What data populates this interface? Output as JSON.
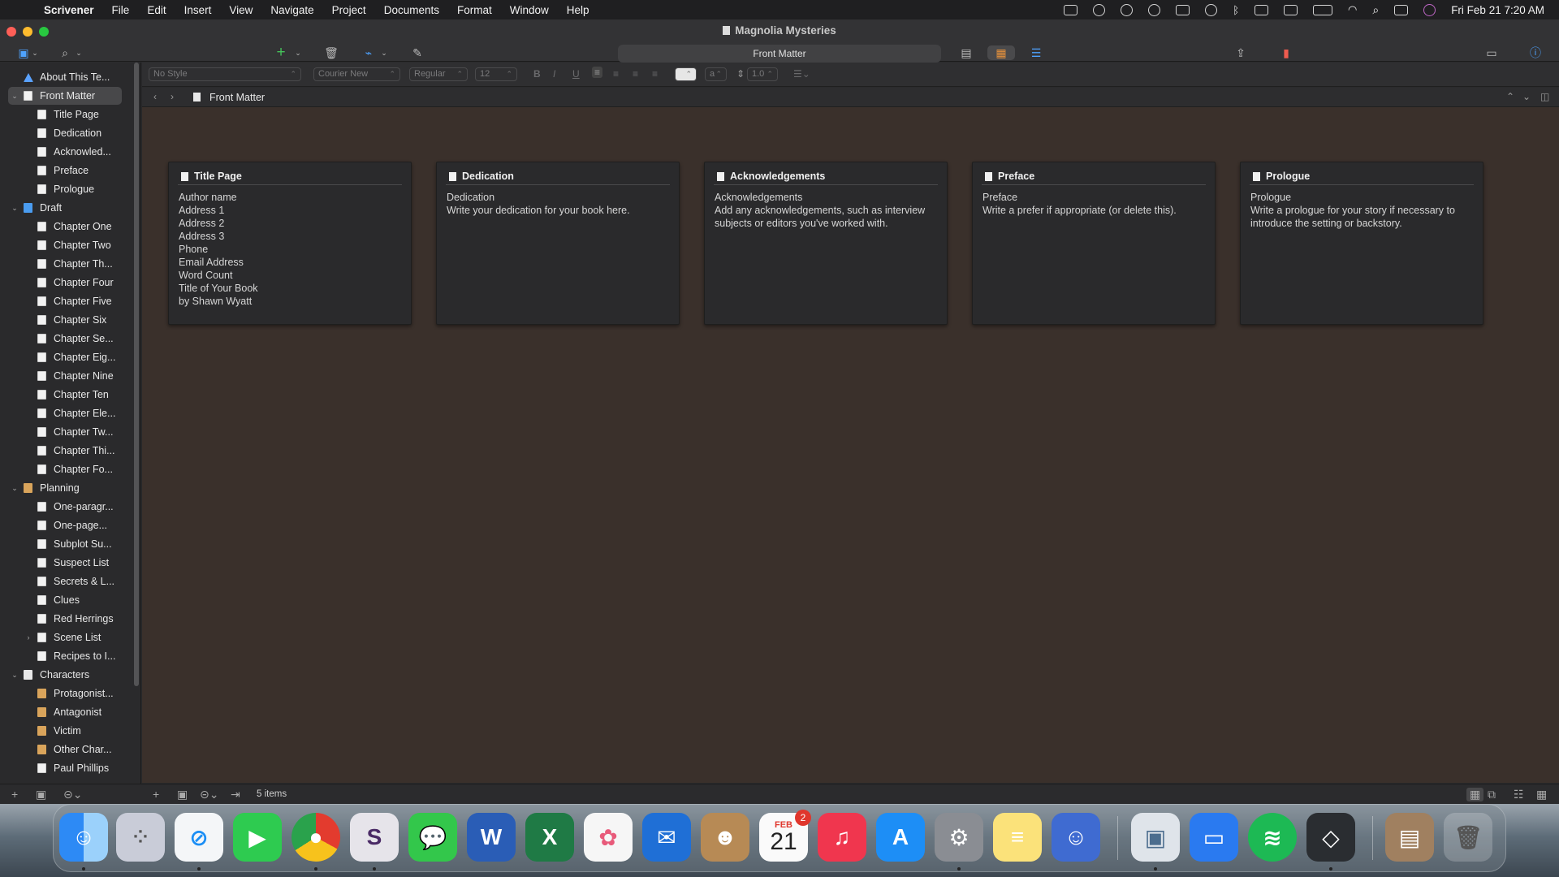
{
  "menubar": {
    "app_name": "Scrivener",
    "items": [
      "File",
      "Edit",
      "Insert",
      "View",
      "Navigate",
      "Project",
      "Documents",
      "Format",
      "Window",
      "Help"
    ],
    "clock": "Fri Feb 21  7:20 AM"
  },
  "window": {
    "title": "Magnolia Mysteries",
    "toolbar_title": "Front Matter"
  },
  "binder": {
    "items": [
      {
        "label": "About This Te...",
        "icon": "warning-icon"
      },
      {
        "label": "Front Matter",
        "icon": "folder-icon",
        "selected": true
      },
      {
        "label": "Title Page",
        "icon": "document-icon"
      },
      {
        "label": "Dedication",
        "icon": "document-icon"
      },
      {
        "label": "Acknowled...",
        "icon": "document-icon"
      },
      {
        "label": "Preface",
        "icon": "document-icon"
      },
      {
        "label": "Prologue",
        "icon": "document-icon"
      },
      {
        "label": "Draft",
        "icon": "draft-folder-icon"
      },
      {
        "label": "Chapter One",
        "icon": "document-icon"
      },
      {
        "label": "Chapter Two",
        "icon": "document-icon"
      },
      {
        "label": "Chapter Th...",
        "icon": "document-icon"
      },
      {
        "label": "Chapter Four",
        "icon": "document-icon"
      },
      {
        "label": "Chapter Five",
        "icon": "document-icon"
      },
      {
        "label": "Chapter Six",
        "icon": "document-icon"
      },
      {
        "label": "Chapter Se...",
        "icon": "document-icon"
      },
      {
        "label": "Chapter Eig...",
        "icon": "document-icon"
      },
      {
        "label": "Chapter Nine",
        "icon": "document-icon"
      },
      {
        "label": "Chapter Ten",
        "icon": "document-icon"
      },
      {
        "label": "Chapter Ele...",
        "icon": "document-icon"
      },
      {
        "label": "Chapter Tw...",
        "icon": "document-icon"
      },
      {
        "label": "Chapter Thi...",
        "icon": "document-icon"
      },
      {
        "label": "Chapter Fo...",
        "icon": "document-icon"
      },
      {
        "label": "Planning",
        "icon": "planning-folder-icon"
      },
      {
        "label": "One-paragr...",
        "icon": "document-icon"
      },
      {
        "label": "One-page...",
        "icon": "document-icon"
      },
      {
        "label": "Subplot Su...",
        "icon": "document-icon"
      },
      {
        "label": "Suspect List",
        "icon": "table-icon"
      },
      {
        "label": "Secrets & L...",
        "icon": "document-icon"
      },
      {
        "label": "Clues",
        "icon": "document-icon"
      },
      {
        "label": "Red Herrings",
        "icon": "document-icon"
      },
      {
        "label": "Scene List",
        "icon": "folder-icon"
      },
      {
        "label": "Recipes to I...",
        "icon": "document-icon"
      },
      {
        "label": "Characters",
        "icon": "characters-folder-icon"
      },
      {
        "label": "Protagonist...",
        "icon": "character-sheet-icon"
      },
      {
        "label": "Antagonist",
        "icon": "character-sheet-icon"
      },
      {
        "label": "Victim",
        "icon": "character-sheet-icon"
      },
      {
        "label": "Other Char...",
        "icon": "character-sheet-icon"
      },
      {
        "label": "Paul Phillips",
        "icon": "document-icon"
      }
    ]
  },
  "formatbar": {
    "style": "No Style",
    "font": "Courier New",
    "weight": "Regular",
    "size": "12",
    "line_spacing": "1.0",
    "bold": "B",
    "italic": "I",
    "underline": "U",
    "highlight": "a"
  },
  "header": {
    "title": "Front Matter"
  },
  "cards": [
    {
      "title": "Title Page",
      "body": "Author name\nAddress 1\nAddress 2\nAddress 3\nPhone\nEmail Address\nWord Count\nTitle of Your Book\nby Shawn Wyatt"
    },
    {
      "title": "Dedication",
      "body": "Dedication\nWrite your dedication for your book here."
    },
    {
      "title": "Acknowledgements",
      "body": "Acknowledgements\nAdd any acknowledgements, such as interview subjects or editors you've worked with."
    },
    {
      "title": "Preface",
      "body": "Preface\nWrite a prefer if appropriate (or delete this)."
    },
    {
      "title": "Prologue",
      "body": "Prologue\nWrite a prologue for your story if necessary to introduce the setting or backstory."
    }
  ],
  "footer": {
    "count": "5 items"
  },
  "dock": {
    "calendar_month": "FEB",
    "calendar_day": "21",
    "calendar_badge": "2"
  },
  "colors": {
    "corkboard": "#3a302b",
    "card": "#2a2a2c",
    "accent": "#4ea3ff"
  }
}
